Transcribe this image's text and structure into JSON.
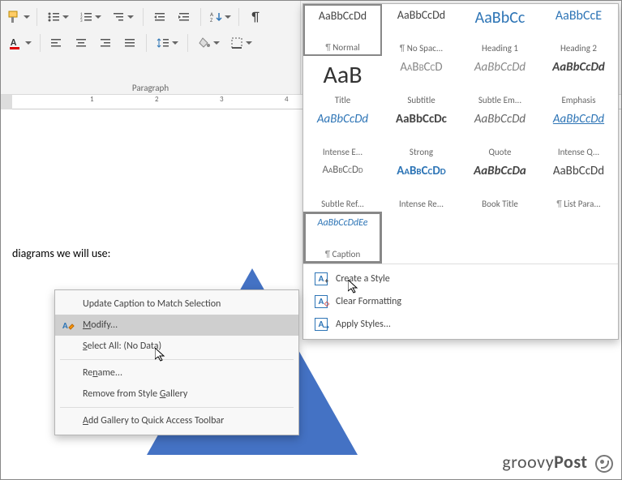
{
  "ribbon": {
    "paragraph_group_label": "Paragraph"
  },
  "document": {
    "visible_text": "diagrams we will use:"
  },
  "styles": {
    "row1": [
      {
        "preview": "AaBbCcDd",
        "label": "Normal",
        "cls": "pv-normal",
        "pilcrow": true,
        "selected": true
      },
      {
        "preview": "AaBbCcDd",
        "label": "No Spac...",
        "cls": "pv-normal",
        "pilcrow": true
      },
      {
        "preview": "AaBbCc",
        "label": "Heading 1",
        "cls": "pv-h1"
      },
      {
        "preview": "AaBbCcE",
        "label": "Heading 2",
        "cls": "pv-h2"
      }
    ],
    "row2": [
      {
        "preview": "AaB",
        "label": "Title",
        "cls": "pv-title"
      },
      {
        "preview": "AaBbCcD",
        "label": "Subtitle",
        "cls": "pv-subtitle"
      },
      {
        "preview": "AaBbCcDd",
        "label": "Subtle Em...",
        "cls": "pv-subtle-em"
      },
      {
        "preview": "AaBbCcDd",
        "label": "Emphasis",
        "cls": "pv-em"
      }
    ],
    "row3": [
      {
        "preview": "AaBbCcDd",
        "label": "Intense E...",
        "cls": "pv-intense"
      },
      {
        "preview": "AaBbCcDc",
        "label": "Strong",
        "cls": "pv-strong"
      },
      {
        "preview": "AaBbCcDd",
        "label": "Quote",
        "cls": "pv-quote"
      },
      {
        "preview": "AaBbCcDd",
        "label": "Intense Q...",
        "cls": "pv-iquote"
      }
    ],
    "row4": [
      {
        "preview": "AaBbCcDd",
        "label": "Subtle Ref...",
        "cls": "pv-subtleref"
      },
      {
        "preview": "AaBbCcDd",
        "label": "Intense Re...",
        "cls": "pv-intenseref"
      },
      {
        "preview": "AaBbCcDa",
        "label": "Book Title",
        "cls": "pv-book"
      },
      {
        "preview": "AaBbCcDd",
        "label": "List Para...",
        "cls": "pv-list",
        "pilcrow": true
      }
    ],
    "row5": [
      {
        "preview": "AaBbCcDdEe",
        "label": "Caption",
        "cls": "pv-caption",
        "pilcrow": true,
        "highlight": true
      }
    ],
    "footer": {
      "create": "Create a Style",
      "clear": "Clear Formatting",
      "apply": "Apply Styles..."
    }
  },
  "context_menu": {
    "items": [
      {
        "key": "update",
        "html": "Update Caption to Match Selection"
      },
      {
        "key": "modify",
        "html": "<u class='accel'>M</u>odify...",
        "icon": true,
        "hover": true
      },
      {
        "key": "select",
        "html": "<u class='accel'>S</u>elect All: (No Data)"
      },
      {
        "key": "sep"
      },
      {
        "key": "rename",
        "html": "Re<u class='accel'>n</u>ame..."
      },
      {
        "key": "remove",
        "html": "Remove from Style <u class='accel'>G</u>allery"
      },
      {
        "key": "sep"
      },
      {
        "key": "qat",
        "html": "<u class='accel'>A</u>dd Gallery to Quick Access Toolbar"
      }
    ]
  },
  "watermark": {
    "text1": "groovy",
    "text2": "Post"
  }
}
